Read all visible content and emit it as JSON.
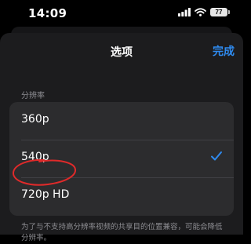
{
  "status_bar": {
    "time": "14:09",
    "battery_level": "77"
  },
  "nav": {
    "title": "选项",
    "done_label": "完成"
  },
  "section": {
    "header": "分辨率",
    "options": [
      {
        "label": "360p",
        "selected": false
      },
      {
        "label": "540p",
        "selected": true
      },
      {
        "label": "720p HD",
        "selected": false
      }
    ],
    "footnote": "为了与不支持高分辨率视频的共享目的位置兼容，可能会降低分辨率。"
  },
  "colors": {
    "accent": "#2f8bf0",
    "annotation": "#e02a2a",
    "sheet": "#1c1c1e",
    "row": "#2c2c2e"
  }
}
